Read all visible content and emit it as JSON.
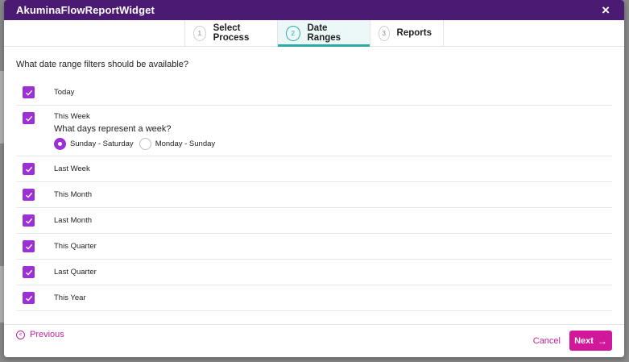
{
  "dialog": {
    "title": "AkuminaFlowReportWidget",
    "close_icon": "×"
  },
  "steps": [
    {
      "number": "1",
      "label": "Select Process"
    },
    {
      "number": "2",
      "label": "Date Ranges"
    },
    {
      "number": "3",
      "label": "Reports"
    }
  ],
  "question": "What date range filters should be available?",
  "options": [
    {
      "label": "Today",
      "checked": true
    },
    {
      "label": "This Week",
      "checked": true
    },
    {
      "label": "Last Week",
      "checked": true
    },
    {
      "label": "This Month",
      "checked": true
    },
    {
      "label": "Last Month",
      "checked": true
    },
    {
      "label": "This Quarter",
      "checked": true
    },
    {
      "label": "Last Quarter",
      "checked": true
    },
    {
      "label": "This Year",
      "checked": true
    }
  ],
  "week_question": "What days represent a week?",
  "week_options": [
    {
      "label": "Sunday - Saturday",
      "selected": true
    },
    {
      "label": "Monday - Sunday",
      "selected": false
    }
  ],
  "footer": {
    "previous_label": "Previous",
    "cancel_label": "Cancel",
    "next_label": "Next",
    "next_arrow": "→",
    "previous_arrow": "<"
  },
  "colors": {
    "header": "#4b1a73",
    "checkbox": "#9b30d4",
    "accent": "#d1189a",
    "active_step": "#2ea8a8"
  }
}
